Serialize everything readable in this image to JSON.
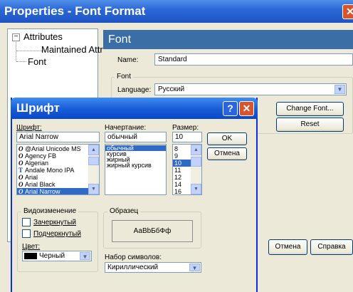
{
  "props_window": {
    "title": "Properties - Font Format",
    "close_glyph": "✕"
  },
  "tree": {
    "expander": "−",
    "items": [
      {
        "label": "Attributes"
      },
      {
        "label": "Maintained Attributes"
      },
      {
        "label": "Font"
      }
    ]
  },
  "font_panel": {
    "header": "Font",
    "name_label": "Name:",
    "name_value": "Standard",
    "font_group_title": "Font",
    "language_label": "Language:",
    "language_value": "Русский",
    "change_font_button": "Change Font...",
    "reset_button": "Reset"
  },
  "props_footer": {
    "cancel_button": "Отмена",
    "help_button": "Справка"
  },
  "font_dialog": {
    "title": "Шрифт",
    "help_glyph": "?",
    "close_glyph": "✕",
    "font_label": "Шрифт:",
    "font_value": "Arial Narrow",
    "font_list": [
      {
        "glyph": "O",
        "tt": false,
        "name": "@Arial Unicode MS"
      },
      {
        "glyph": "O",
        "tt": false,
        "name": "Agency FB"
      },
      {
        "glyph": "O",
        "tt": false,
        "name": "Algerian"
      },
      {
        "glyph": "T",
        "tt": true,
        "name": "Andale Mono IPA"
      },
      {
        "glyph": "O",
        "tt": false,
        "name": "Arial"
      },
      {
        "glyph": "O",
        "tt": false,
        "name": "Arial Black"
      },
      {
        "glyph": "O",
        "tt": false,
        "name": "Arial Narrow"
      }
    ],
    "font_selected_index": 6,
    "style_label": "Начертание:",
    "style_value": "обычный",
    "style_list": [
      "обычный",
      "курсив",
      "жирный",
      "жирный курсив"
    ],
    "style_selected_index": 0,
    "size_label": "Размер:",
    "size_value": "10",
    "size_list": [
      "8",
      "9",
      "10",
      "11",
      "12",
      "14",
      "16"
    ],
    "size_selected_index": 2,
    "ok_button": "OK",
    "cancel_button": "Отмена",
    "effects_title": "Видоизменение",
    "strikeout_label": "Зачеркнутый",
    "underline_label": "Подчеркнутый",
    "color_label": "Цвет:",
    "color_value": "Черный",
    "color_swatch": "#000000",
    "sample_title": "Образец",
    "sample_text": "АаВbБбФф",
    "charset_label": "Набор символов:",
    "charset_value": "Кириллический"
  },
  "colors": {
    "title_blue": "#2a66d6",
    "panel_header": "#3a6ea5",
    "selection": "#316ac5"
  }
}
